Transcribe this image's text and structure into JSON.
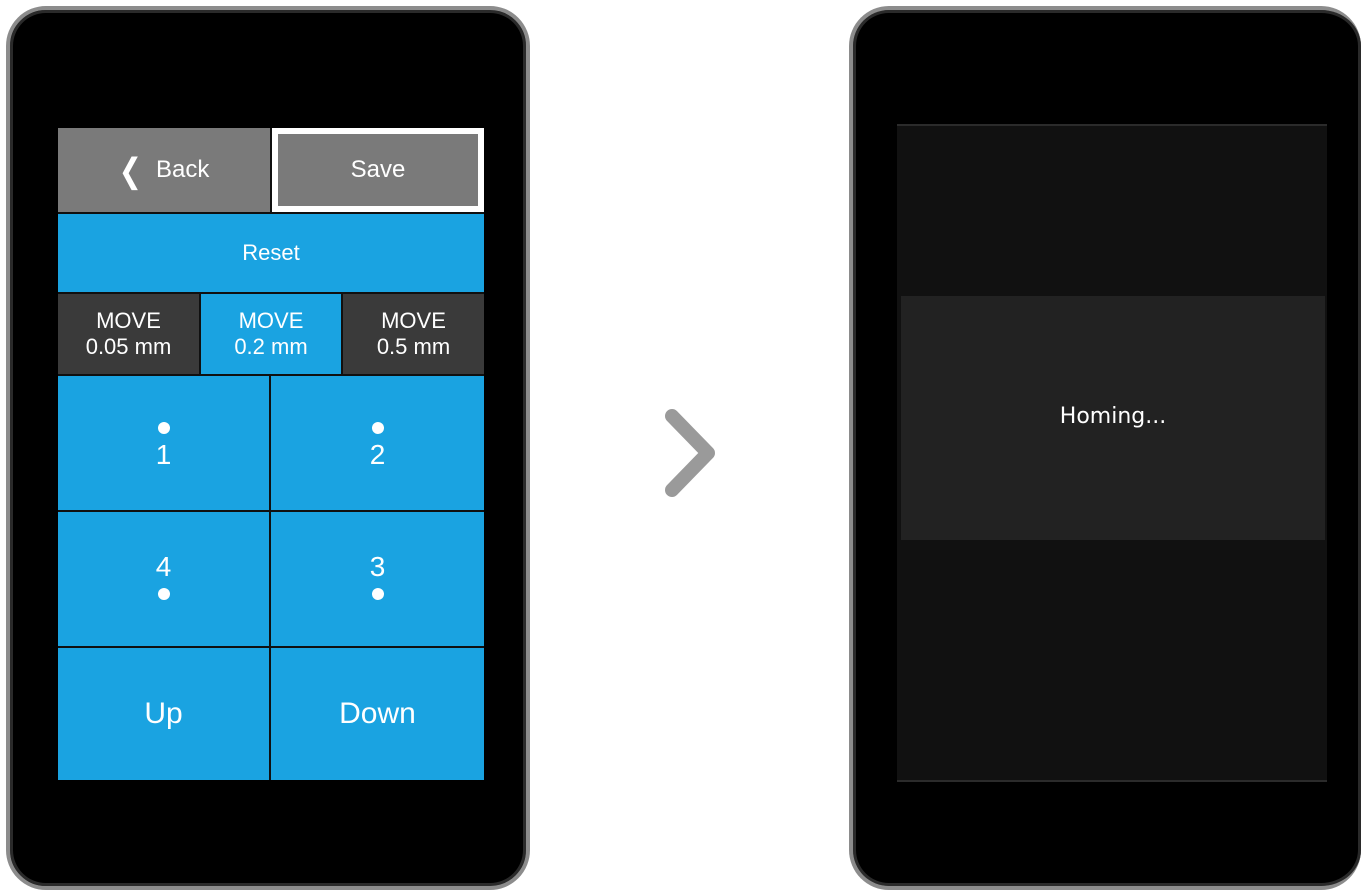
{
  "left_screen": {
    "back_label": "Back",
    "save_label": "Save",
    "reset_label": "Reset",
    "move_options": [
      {
        "title": "MOVE",
        "amount": "0.05 mm",
        "selected": false
      },
      {
        "title": "MOVE",
        "amount": "0.2 mm",
        "selected": true
      },
      {
        "title": "MOVE",
        "amount": "0.5 mm",
        "selected": false
      }
    ],
    "points": [
      "1",
      "2",
      "4",
      "3"
    ],
    "up_label": "Up",
    "down_label": "Down"
  },
  "right_screen": {
    "status_text": "Homing..."
  },
  "icons": {
    "transition": "chevron-right-icon",
    "back": "chevron-left-icon"
  },
  "colors": {
    "accent": "#1aa3e1",
    "button_gray": "#7a7a7a",
    "unselected_move": "#3a3a3a",
    "highlight_border": "#ffffff"
  }
}
